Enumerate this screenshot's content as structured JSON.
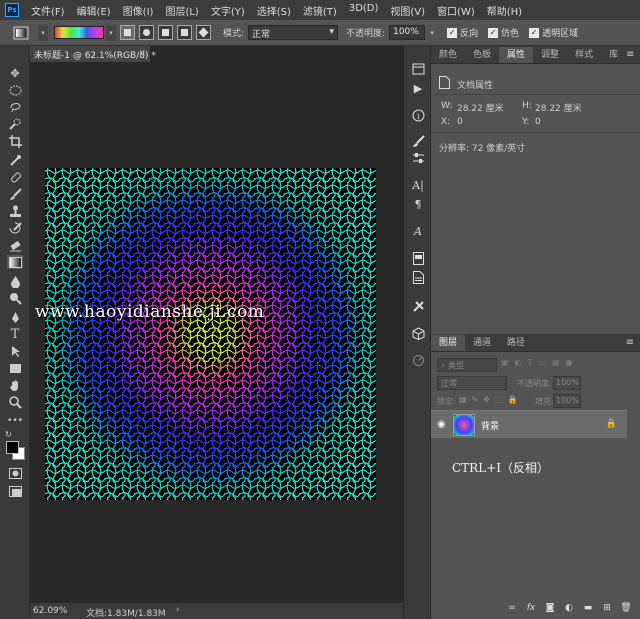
{
  "app": {
    "logo": "Ps"
  },
  "menu": [
    "文件(F)",
    "编辑(E)",
    "图像(I)",
    "图层(L)",
    "文字(Y)",
    "选择(S)",
    "滤镜(T)",
    "3D(D)",
    "视图(V)",
    "窗口(W)",
    "帮助(H)"
  ],
  "options": {
    "mode_label": "模式:",
    "mode_value": "正常",
    "opacity_label": "不透明度:",
    "opacity_value": "100%",
    "checks": [
      {
        "label": "反向",
        "checked": true
      },
      {
        "label": "仿色",
        "checked": true
      },
      {
        "label": "透明区域",
        "checked": true
      }
    ]
  },
  "document": {
    "tab_title": "未标题-1 @ 62.1%(RGB/8) *",
    "watermark": "www.haoyidianshe ji.com",
    "zoom": "62.09%",
    "doc_size": "文档:1.83M/1.83M"
  },
  "properties_panel": {
    "tabs": [
      "颜色",
      "色板",
      "属性",
      "调整",
      "样式",
      "库"
    ],
    "active_tab": "属性",
    "section_title": "文档属性",
    "w_label": "W:",
    "w_value": "28.22 厘米",
    "h_label": "H:",
    "h_value": "28.22 厘米",
    "x_label": "X:",
    "x_value": "0",
    "y_label": "Y:",
    "y_value": "0",
    "resolution": "分辨率: 72 像素/英寸"
  },
  "layers_panel": {
    "tabs": [
      "图层",
      "通道",
      "路径"
    ],
    "active_tab": "图层",
    "kind_label": "类型",
    "blend_mode": "正常",
    "opacity_label": "不透明度:",
    "opacity_value": "100%",
    "lock_label": "锁定:",
    "fill_label": "填充:",
    "fill_value": "100%",
    "layer_name": "背景"
  },
  "annotation": "CTRL+I（反相）",
  "colors": {
    "accent": "#31a8ff",
    "panel": "#535353",
    "dark": "#282828"
  }
}
